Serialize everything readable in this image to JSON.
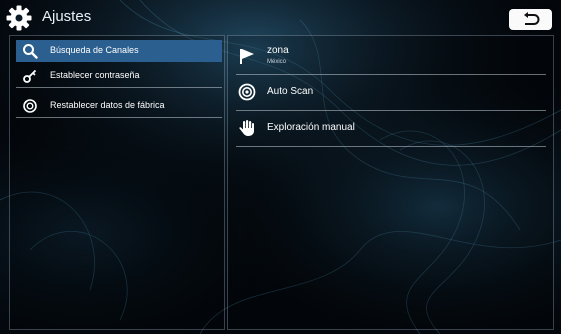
{
  "header": {
    "title": "Ajustes",
    "icon": "gear-icon",
    "back_icon": "back-arrow-icon"
  },
  "left_menu": {
    "items": [
      {
        "label": "Búsqueda de Canales",
        "icon": "search-icon",
        "active": true
      },
      {
        "label": "Establecer contraseña",
        "icon": "key-icon",
        "active": false
      },
      {
        "label": "Restablecer datos de fábrica",
        "icon": "reset-icon",
        "active": false
      }
    ]
  },
  "right_menu": {
    "items": [
      {
        "label": "zona",
        "sub": "México",
        "icon": "flag-icon"
      },
      {
        "label": "Auto Scan",
        "icon": "target-icon"
      },
      {
        "label": "Exploración manual",
        "icon": "hand-icon"
      }
    ]
  },
  "colors": {
    "active_item": "#2b5f8f",
    "background": "#03070c",
    "divider": "#bec8d2"
  }
}
